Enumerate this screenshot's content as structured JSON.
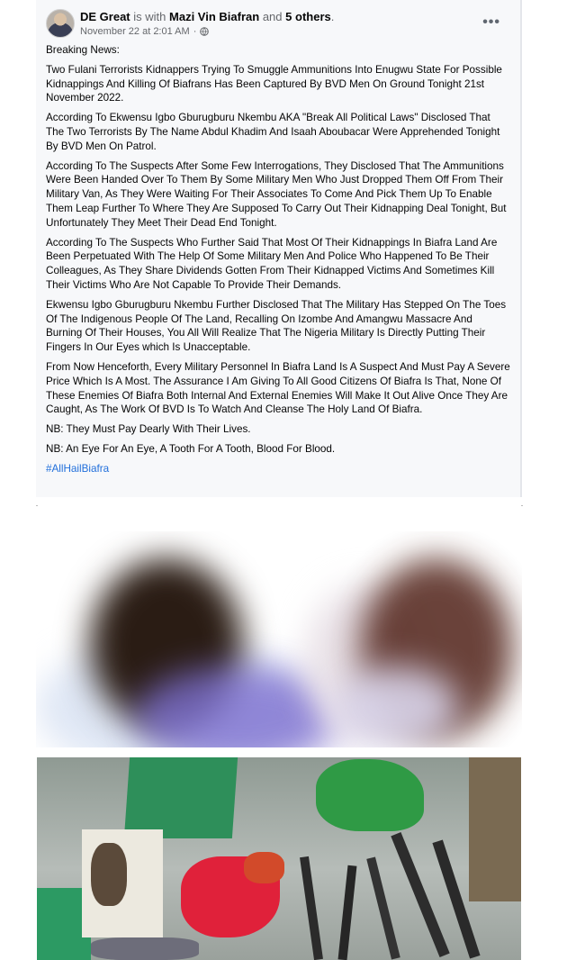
{
  "post": {
    "author": "DE Great",
    "with_text": "is with",
    "tagged": "Mazi Vin Biafran",
    "and_text": "and",
    "others": "5 others",
    "period": ".",
    "timestamp": "November 22 at 2:01 AM",
    "separator": "·",
    "more_label": "•••",
    "paragraphs": [
      "Breaking News:",
      "Two Fulani Terrorists Kidnappers Trying To Smuggle Ammunitions Into Enugwu State For Possible Kidnappings And Killing Of Biafrans Has Been Captured By BVD Men On Ground Tonight 21st November 2022.",
      "According To Ekwensu Igbo Gburugburu Nkembu AKA \"Break All Political Laws\" Disclosed That The Two Terrorists By The Name Abdul Khadim And Isaah Aboubacar Were Apprehended Tonight By BVD Men On Patrol.",
      "According To The Suspects After Some Few Interrogations, They Disclosed That The Ammunitions Were Been Handed Over To Them By Some Military Men Who Just Dropped Them Off From Their Military Van, As They Were Waiting For Their Associates To Come And Pick Them Up To Enable Them Leap Further To Where They Are Supposed To Carry Out Their Kidnapping Deal Tonight, But Unfortunately They Meet Their Dead End Tonight.",
      "According To The Suspects Who Further Said That Most Of Their Kidnappings In Biafra Land Are Been Perpetuated With The Help Of Some Military Men And Police Who Happened To Be Their Colleagues, As They Share Dividends Gotten From Their Kidnapped Victims And Sometimes Kill Their Victims Who Are Not Capable To Provide Their Demands.",
      "Ekwensu Igbo Gburugburu Nkembu Further Disclosed That The Military Has Stepped On The Toes Of The Indigenous People Of The Land, Recalling On Izombe And Amangwu Massacre And Burning Of  Their Houses, You All Will  Realize That The Nigeria Military Is Directly Putting Their Fingers In Our Eyes which Is Unacceptable.",
      "From Now Henceforth, Every Military Personnel In Biafra Land Is A Suspect And Must Pay A Severe Price Which Is A Most. The Assurance I Am Giving To All Good Citizens Of Biafra Is That, None Of These Enemies Of Biafra Both Internal And External Enemies Will Make It Out Alive Once They Are Caught, As The Work Of BVD Is To Watch And Cleanse The Holy Land Of Biafra.",
      "NB: They Must Pay Dearly With Their Lives.",
      "NB: An Eye For An Eye, A Tooth For A Tooth, Blood For Blood."
    ],
    "hashtag": "#AllHailBiafra"
  },
  "colors": {
    "card_bg": "#f7f8fa",
    "link": "#216fdb",
    "meta": "#65676b",
    "text": "#050505"
  }
}
